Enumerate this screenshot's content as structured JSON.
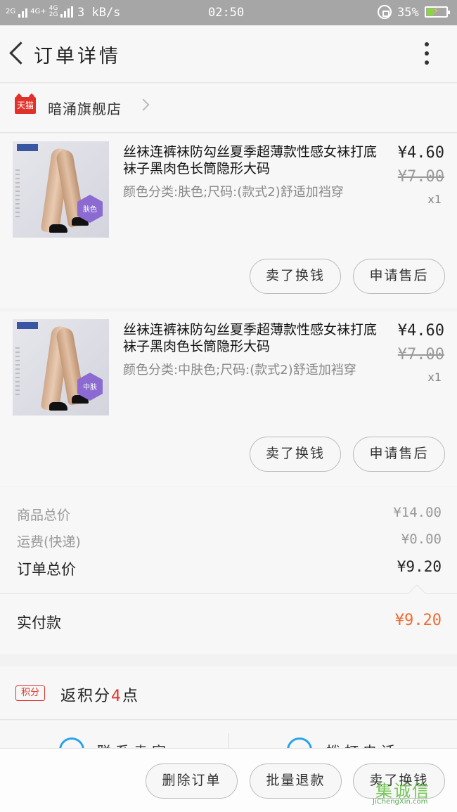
{
  "status_bar": {
    "network_1": "2G",
    "network_2": "4G+",
    "network_3": "4G\n2G",
    "speed": "3 kB/s",
    "time": "02:50",
    "battery_percent": "35%",
    "battery_level": 0.35
  },
  "header": {
    "title": "订单详情",
    "back_icon": "chevron-left-icon",
    "more_icon": "more-vertical-icon"
  },
  "store": {
    "badge": "天猫",
    "name": "暗涌旗舰店",
    "chevron_icon": "chevron-right-icon"
  },
  "items": [
    {
      "title": "丝袜连裤袜防勾丝夏季超薄款性感女袜打底袜子黑肉色长筒隐形大码",
      "spec": "颜色分类:肤色;尺码:(款式2)舒适加裆穿",
      "price": "¥4.60",
      "original_price": "¥7.00",
      "quantity": "x1",
      "image_label": "肤色",
      "sell_button": "卖了换钱",
      "after_sale_button": "申请售后"
    },
    {
      "title": "丝袜连裤袜防勾丝夏季超薄款性感女袜打底袜子黑肉色长筒隐形大码",
      "spec": "颜色分类:中肤色;尺码:(款式2)舒适加裆穿",
      "price": "¥4.60",
      "original_price": "¥7.00",
      "quantity": "x1",
      "image_label": "中肤",
      "sell_button": "卖了换钱",
      "after_sale_button": "申请售后"
    }
  ],
  "summary": {
    "goods_total_label": "商品总价",
    "goods_total": "¥14.00",
    "shipping_label": "运费(快递)",
    "shipping": "¥0.00",
    "order_total_label": "订单总价",
    "order_total": "¥9.20",
    "paid_label": "实付款",
    "paid": "¥9.20",
    "paid_color": "#ef6d32"
  },
  "points": {
    "badge": "积分",
    "prefix": "返积分",
    "number": "4",
    "suffix": "点"
  },
  "contact": {
    "left_text": "联系卖家",
    "right_text": "拨打电话",
    "left_icon": "chat-icon",
    "right_icon": "phone-icon"
  },
  "footer": {
    "delete": "删除订单",
    "refund": "批量退款",
    "sell": "卖了换钱"
  },
  "watermark": {
    "cn": "集诚信",
    "en": "JiChengXin.com"
  },
  "colors": {
    "accent_red": "#e0322b",
    "contact_blue": "#29a3e8"
  }
}
